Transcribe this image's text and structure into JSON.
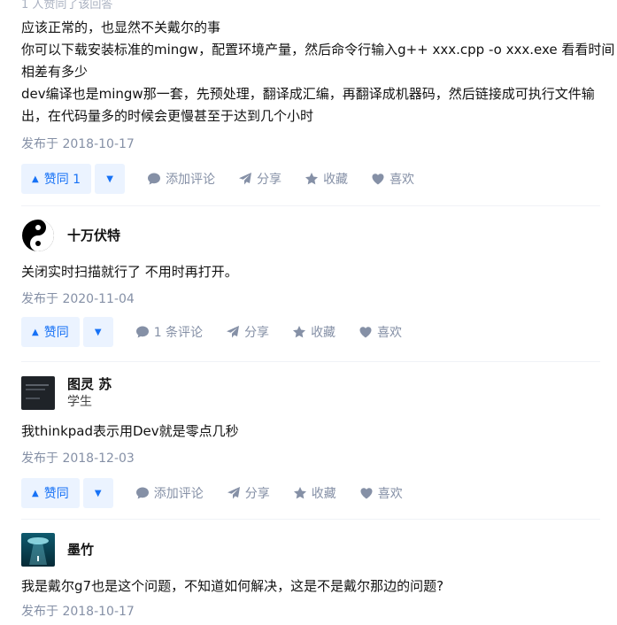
{
  "top_fade_text": "1 人赞同了该回答",
  "answers": [
    {
      "content": [
        "应该正常的，也显然不关戴尔的事",
        "你可以下载安装标准的mingw，配置环境产量，然后命令行输入g++ xxx.cpp -o xxx.exe 看看时间",
        "相差有多少",
        "dev编译也是mingw那一套，先预处理，翻译成汇编，再翻译成机器码，然后链接成可执行文件输",
        "出，在代码量多的时候会更慢甚至于达到几个小时"
      ],
      "date": "发布于 2018-10-17",
      "vote_label": "赞同 1",
      "comment_label": "添加评论",
      "share_label": "分享",
      "favorite_label": "收藏",
      "like_label": "喜欢"
    },
    {
      "author": {
        "name": "十万伏特",
        "headline": ""
      },
      "content": [
        "关闭实时扫描就行了 不用时再打开。"
      ],
      "date": "发布于 2020-11-04",
      "vote_label": "赞同",
      "comment_label": "1 条评论",
      "share_label": "分享",
      "favorite_label": "收藏",
      "like_label": "喜欢"
    },
    {
      "author": {
        "name": "图灵 苏",
        "headline": "学生"
      },
      "content": [
        "我thinkpad表示用Dev就是零点几秒"
      ],
      "date": "发布于 2018-12-03",
      "vote_label": "赞同",
      "comment_label": "添加评论",
      "share_label": "分享",
      "favorite_label": "收藏",
      "like_label": "喜欢"
    },
    {
      "author": {
        "name": "墨竹",
        "headline": ""
      },
      "content": [
        "我是戴尔g7也是这个问题，不知道如何解决，这是不是戴尔那边的问题?"
      ],
      "date": "发布于 2018-10-17"
    }
  ],
  "colors": {
    "accent": "#1772f6",
    "accent_bg": "#ebf3ff",
    "meta": "#8590a6",
    "text": "#121212"
  },
  "icons": {
    "vote_up": "triangle-up-icon",
    "vote_down": "triangle-down-icon",
    "comment": "comment-bubble-icon",
    "share": "paper-plane-icon",
    "favorite": "star-icon",
    "like": "heart-icon"
  }
}
